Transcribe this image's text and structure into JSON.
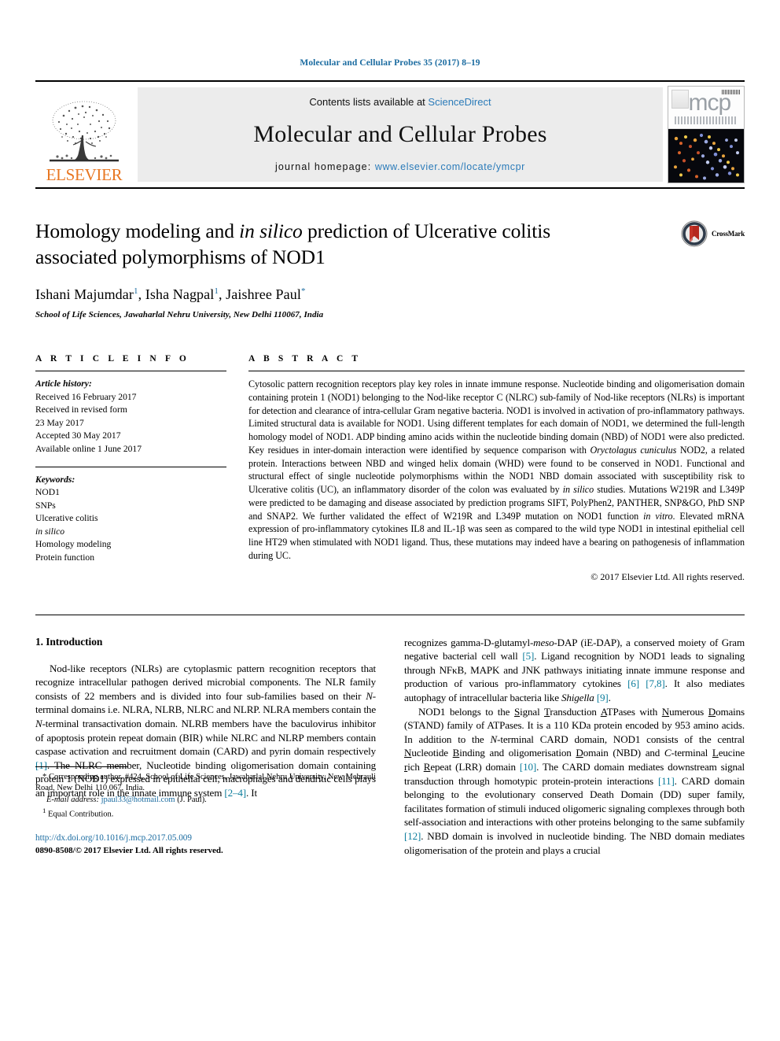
{
  "running_head": "Molecular and Cellular Probes 35 (2017) 8–19",
  "masthead": {
    "publisher_name": "ELSEVIER",
    "contents_prefix": "Contents lists available at ",
    "contents_link": "ScienceDirect",
    "journal_title": "Molecular and Cellular Probes",
    "homepage_prefix": "journal homepage: ",
    "homepage_url": "www.elsevier.com/locate/ymcpr",
    "cover_logo_text": "mcp"
  },
  "article": {
    "title_line1_a": "Homology modeling and ",
    "title_line1_italic": "in silico",
    "title_line1_b": " prediction of Ulcerative colitis",
    "title_line2": "associated polymorphisms of NOD1",
    "authors_plain": "Ishani Majumdar 1, Isha Nagpal 1, Jaishree Paul*",
    "author1": "Ishani Majumdar",
    "author1_sup": "1",
    "author2": "Isha Nagpal",
    "author2_sup": "1",
    "author3": "Jaishree Paul",
    "author3_sup": "*",
    "affiliation": "School of Life Sciences, Jawaharlal Nehru University, New Delhi 110067, India",
    "crossmark_label": "CrossMark"
  },
  "article_info": {
    "heading": "A R T I C L E   I N F O",
    "history_label": "Article history:",
    "history": [
      "Received 16 February 2017",
      "Received in revised form",
      "23 May 2017",
      "Accepted 30 May 2017",
      "Available online 1 June 2017"
    ],
    "keywords_label": "Keywords:",
    "keywords": [
      "NOD1",
      "SNPs",
      "Ulcerative colitis",
      "in silico",
      "Homology modeling",
      "Protein function"
    ],
    "keyword_italic_index": 3
  },
  "abstract": {
    "heading": "A B S T R A C T",
    "part1": "Cytosolic pattern recognition receptors play key roles in innate immune response. Nucleotide binding and oligomerisation domain containing protein 1 (NOD1) belonging to the Nod-like receptor C (NLRC) sub-family of Nod-like receptors (NLRs) is important for detection and clearance of intra-cellular Gram negative bacteria. NOD1 is involved in activation of pro-inflammatory pathways. Limited structural data is available for NOD1. Using different templates for each domain of NOD1, we determined the full-length homology model of NOD1. ADP binding amino acids within the nucleotide binding domain (NBD) of NOD1 were also predicted. Key residues in inter-domain interaction were identified by sequence comparison with ",
    "italic1": "Oryctolagus cuniculus",
    "part2": " NOD2, a related protein. Interactions between NBD and winged helix domain (WHD) were found to be conserved in NOD1. Functional and structural effect of single nucleotide polymorphisms within the NOD1 NBD domain associated with susceptibility risk to Ulcerative colitis (UC), an inflammatory disorder of the colon was evaluated by ",
    "italic2": "in silico",
    "part3": " studies. Mutations W219R and L349P were predicted to be damaging and disease associated by prediction programs SIFT, PolyPhen2, PANTHER, SNP&GO, PhD SNP and SNAP2. We further validated the effect of W219R and L349P mutation on NOD1 function ",
    "italic3": "in vitro",
    "part4": ". Elevated mRNA expression of pro-inflammatory cytokines IL8 and IL-1β was seen as compared to the wild type NOD1 in intestinal epithelial cell line HT29 when stimulated with NOD1 ligand. Thus, these mutations may indeed have a bearing on pathogenesis of inflammation during UC.",
    "copyright": "© 2017 Elsevier Ltd. All rights reserved."
  },
  "introduction": {
    "heading": "1. Introduction",
    "left_p1_a": "Nod-like receptors (NLRs) are cytoplasmic pattern recognition receptors that recognize intracellular pathogen derived microbial components. The NLR family consists of 22 members and is divided into four sub-families based on their ",
    "left_p1_italic_N1": "N",
    "left_p1_b": "-terminal domains i.e. NLRA, NLRB, NLRC and NLRP. NLRA members contain the ",
    "left_p1_italic_N2": "N",
    "left_p1_c": "-terminal transactivation domain. NLRB members have the baculovirus inhibitor of apoptosis protein repeat domain (BIR) while NLRC and NLRP members contain caspase activation and recruitment domain (CARD) and pyrin domain respectively ",
    "left_ref1": "[1]",
    "left_p1_d": ". The NLRC member, Nucleotide binding oligomerisation domain containing protein 1 (NOD1) expressed in epithelial cell, macrophages and dendritic cells plays an important role in the innate immune system ",
    "left_ref2": "[2–4]",
    "left_p1_e": ". It",
    "right_p1_a": "recognizes gamma-D-glutamyl-",
    "right_p1_italic_meso": "meso",
    "right_p1_b": "-DAP (iE-DAP), a conserved moiety of Gram negative bacterial cell wall ",
    "right_ref5": "[5]",
    "right_p1_c": ". Ligand recognition by NOD1 leads to signaling through NFκB, MAPK and JNK pathways initiating innate immune response and production of various pro-inflammatory cytokines ",
    "right_ref6": "[6]",
    "right_ref78": "[7,8]",
    "right_p1_d": ". It also mediates autophagy of intracellular bacteria like ",
    "right_p1_italic_shigella": "Shigella",
    "right_ref9": "[9]",
    "right_p1_e": ".",
    "right_p2_a": "NOD1 belongs to the ",
    "right_p2_u1": "S",
    "right_p2_t1": "ignal ",
    "right_p2_u2": "T",
    "right_p2_t2": "ransduction ",
    "right_p2_u3": "A",
    "right_p2_t3": "TPases with ",
    "right_p2_u4": "N",
    "right_p2_t4": "umerous ",
    "right_p2_u5": "D",
    "right_p2_t5": "omains (STAND) family of ATPases. It is a 110 KDa protein encoded by 953 amino acids. In addition to the ",
    "right_p2_italic_N": "N",
    "right_p2_t6": "-terminal CARD domain, NOD1 consists of the central ",
    "right_p2_u6": "N",
    "right_p2_t7": "ucleotide ",
    "right_p2_u7": "B",
    "right_p2_t8": "inding and oligomerisation ",
    "right_p2_u8": "D",
    "right_p2_t9": "omain (NBD) and ",
    "right_p2_italic_C": "C",
    "right_p2_t10": "-terminal ",
    "right_p2_u9": "L",
    "right_p2_t11": "eucine ",
    "right_p2_u10": "r",
    "right_p2_t12": "ich ",
    "right_p2_u11": "R",
    "right_p2_t13": "epeat (LRR) domain ",
    "right_ref10": "[10]",
    "right_p2_t14": ". The CARD domain mediates downstream signal transduction through homotypic protein-protein interactions ",
    "right_ref11": "[11]",
    "right_p2_t15": ". CARD domain belonging to the evolutionary conserved Death Domain (DD) super family, facilitates formation of stimuli induced oligomeric signaling complexes through both self-association and interactions with other proteins belonging to the same subfamily ",
    "right_ref12": "[12]",
    "right_p2_t16": ". NBD domain is involved in nucleotide binding. The NBD domain mediates oligomerisation of the protein and plays a crucial"
  },
  "footnotes": {
    "corresponding": "* Corresponding author. #424, School of Life Sciences, Jawaharlal Nehru University, New Mehrauli Road, New Delhi 110 067, India.",
    "email_label": "E-mail address:",
    "email": "jpaul33@hotmail.com",
    "email_suffix": "(J. Paul).",
    "equal_contribution_sup": "1",
    "equal_contribution": "Equal Contribution.",
    "doi": "http://dx.doi.org/10.1016/j.mcp.2017.05.009",
    "issn_line": "0890-8508/© 2017 Elsevier Ltd. All rights reserved."
  },
  "colors": {
    "link_blue": "#1a6ba0",
    "ref_teal": "#0b7c9b",
    "elsevier_orange": "#E87722",
    "masthead_grey": "#ececec"
  }
}
